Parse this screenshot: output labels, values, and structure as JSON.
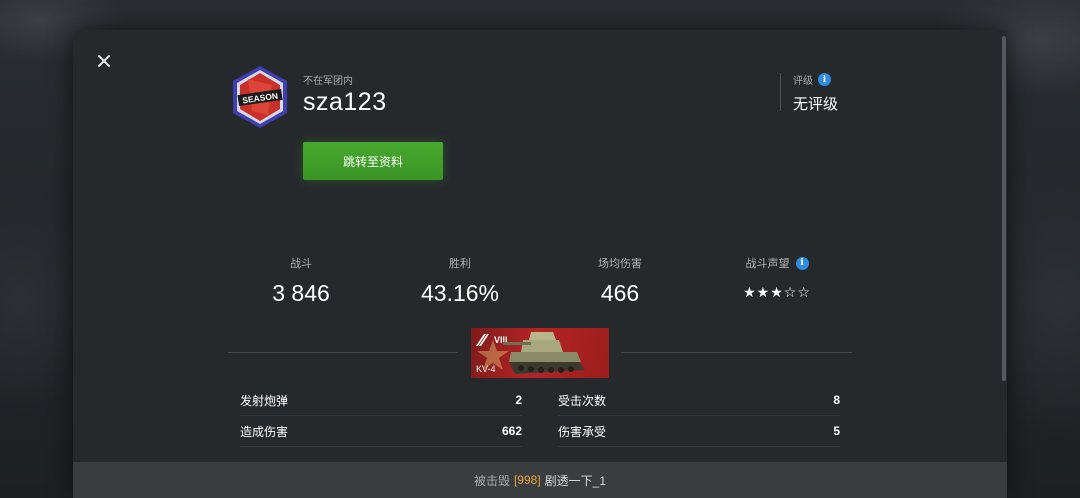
{
  "header": {
    "clan_status": "不在军团内",
    "player_name": "sza123",
    "badge_text": "SEASON",
    "profile_button": "跳转至资料",
    "rating_label": "评级",
    "rating_value": "无评级"
  },
  "stats": [
    {
      "label": "战斗",
      "value": "3 846"
    },
    {
      "label": "胜利",
      "value": "43.16%"
    },
    {
      "label": "场均伤害",
      "value": "466"
    },
    {
      "label": "战斗声望",
      "value": "★★★☆☆",
      "stars": 3,
      "stars_max": 5
    }
  ],
  "tank": {
    "tier": "VIII",
    "name": "KV-4"
  },
  "battle_stats": {
    "left": [
      {
        "label": "发射炮弹",
        "value": "2"
      },
      {
        "label": "造成伤害",
        "value": "662"
      }
    ],
    "right": [
      {
        "label": "受击次数",
        "value": "8"
      },
      {
        "label": "伤害承受",
        "value": "5"
      }
    ]
  },
  "footer": {
    "killed_label": "被击毁",
    "clan_tag": "[998]",
    "killer_name": "剧透一下_1"
  },
  "colors": {
    "accent_green": "#3a9524",
    "info_blue": "#2e8be0",
    "tank_card_red": "#b42424",
    "clan_tag_orange": "#e6a53a"
  }
}
